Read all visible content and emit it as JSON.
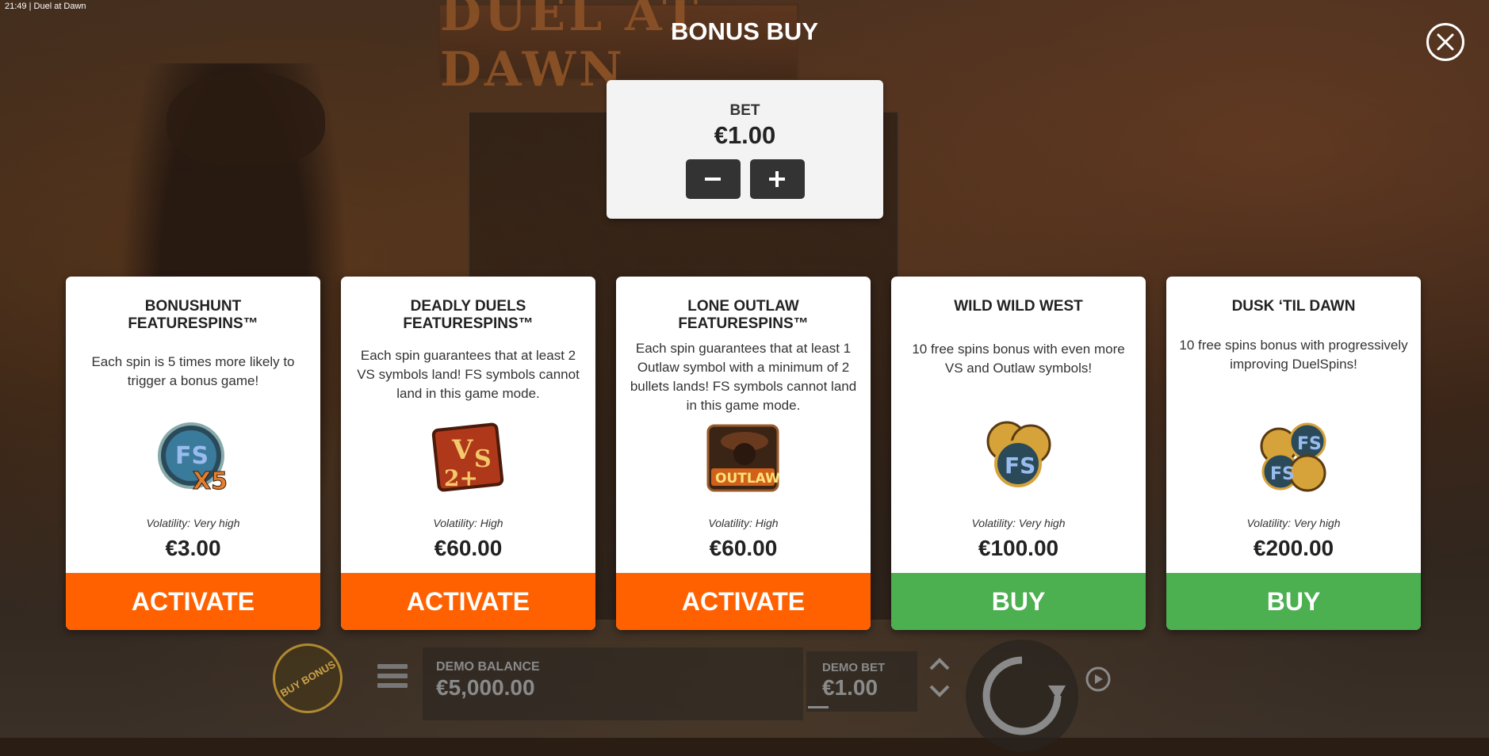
{
  "status_bar": {
    "time": "21:49",
    "separator": "|",
    "app_title": "Duel at Dawn"
  },
  "background_logo": "DUEL AT DAWN",
  "header": {
    "title": "BONUS BUY"
  },
  "bet_panel": {
    "label": "BET",
    "value": "€1.00",
    "minus_icon": "minus-icon",
    "plus_icon": "plus-icon"
  },
  "colors": {
    "activate": "#ff6100",
    "buy": "#4caf50",
    "panel": "#f3f3f3",
    "dark_button": "#333333"
  },
  "cards": [
    {
      "title": "BONUSHUNT\nFEATURESPINS™",
      "description": "Each spin is 5 times more likely to trigger a bonus game!",
      "icon": "fs-x5-icon",
      "volatility": "Volatility: Very high",
      "price": "€3.00",
      "button": "ACTIVATE"
    },
    {
      "title": "DEADLY DUELS\nFEATURESPINS™",
      "description": "Each spin guarantees that at least 2 VS symbols land! FS symbols cannot land in this game mode.",
      "icon": "vs-2plus-icon",
      "volatility": "Volatility: High",
      "price": "€60.00",
      "button": "ACTIVATE"
    },
    {
      "title": "LONE OUTLAW\nFEATURESPINS™",
      "description": "Each spin guarantees that at least 1 Outlaw symbol with a minimum of 2 bullets lands! FS symbols cannot land in this game mode.",
      "icon": "outlaw-icon",
      "volatility": "Volatility: High",
      "price": "€60.00",
      "button": "ACTIVATE"
    },
    {
      "title": "WILD WILD WEST",
      "description": "10 free spins bonus with even more VS and Outlaw symbols!",
      "icon": "fs-coins-three-icon",
      "volatility": "Volatility: Very high",
      "price": "€100.00",
      "button": "BUY"
    },
    {
      "title": "DUSK ‘TIL DAWN",
      "description": "10 free spins bonus with progressively improving DuelSpins!",
      "icon": "fs-coins-four-icon",
      "volatility": "Volatility: Very high",
      "price": "€200.00",
      "button": "BUY"
    }
  ],
  "bottom_bar": {
    "buy_bonus": "BUY BONUS",
    "demo_balance_label": "DEMO BALANCE",
    "demo_balance_value": "€5,000.00",
    "demo_bet_label": "DEMO BET",
    "demo_bet_value": "€1.00"
  }
}
